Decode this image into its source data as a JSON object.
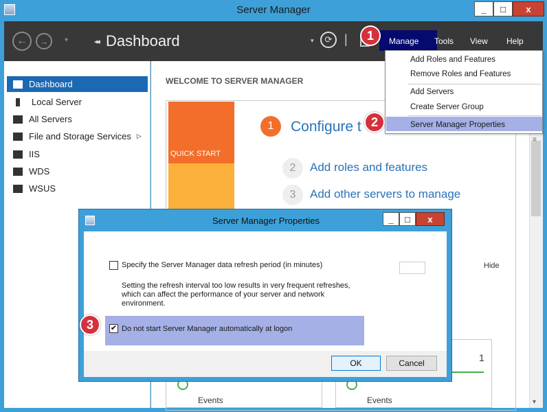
{
  "window": {
    "title": "Server Manager",
    "minimize": "_",
    "maximize": "□",
    "close": "x"
  },
  "navbar": {
    "title": "Dashboard",
    "title_arrows": "◂◂",
    "menus": [
      "Manage",
      "Tools",
      "View",
      "Help"
    ]
  },
  "sidebar": {
    "items": [
      {
        "label": "Dashboard",
        "selected": true
      },
      {
        "label": "Local Server"
      },
      {
        "label": "All Servers"
      },
      {
        "label": "File and Storage Services",
        "has_submenu": true
      },
      {
        "label": "IIS"
      },
      {
        "label": "WDS"
      },
      {
        "label": "WSUS"
      }
    ]
  },
  "main": {
    "welcome": "WELCOME TO SERVER MANAGER",
    "quick_start": "QUICK START",
    "steps": [
      {
        "num": "1",
        "label": "Configure t"
      },
      {
        "num": "2",
        "label": "Add roles and features"
      },
      {
        "num": "3",
        "label": "Add other servers to manage"
      }
    ],
    "hide": "Hide",
    "tile_count": "1",
    "events": "Events"
  },
  "manage_menu": {
    "items": [
      "Add Roles and Features",
      "Remove Roles and Features",
      "Add Servers",
      "Create Server Group",
      "Server Manager Properties"
    ],
    "highlighted": "Server Manager Properties"
  },
  "dialog": {
    "title": "Server Manager Properties",
    "refresh_option": "Specify the Server Manager data refresh period (in minutes)",
    "refresh_checked": false,
    "warning_line1": "Setting the refresh interval too low results in very frequent refreshes,",
    "warning_line2": "which can affect the performance of your server and network",
    "warning_line3": "environment.",
    "autostart_option": "Do not start Server Manager automatically at logon",
    "autostart_checked": true,
    "ok": "OK",
    "cancel": "Cancel"
  },
  "callouts": [
    "1",
    "2",
    "3"
  ],
  "colors": {
    "accent_blue": "#3da0d8",
    "nav_dark": "#383838",
    "selection_blue": "#1c69b3",
    "quick_start_orange": "#f26e2a",
    "highlight": "#a4b0e6",
    "callout_red": "#d4313d"
  }
}
